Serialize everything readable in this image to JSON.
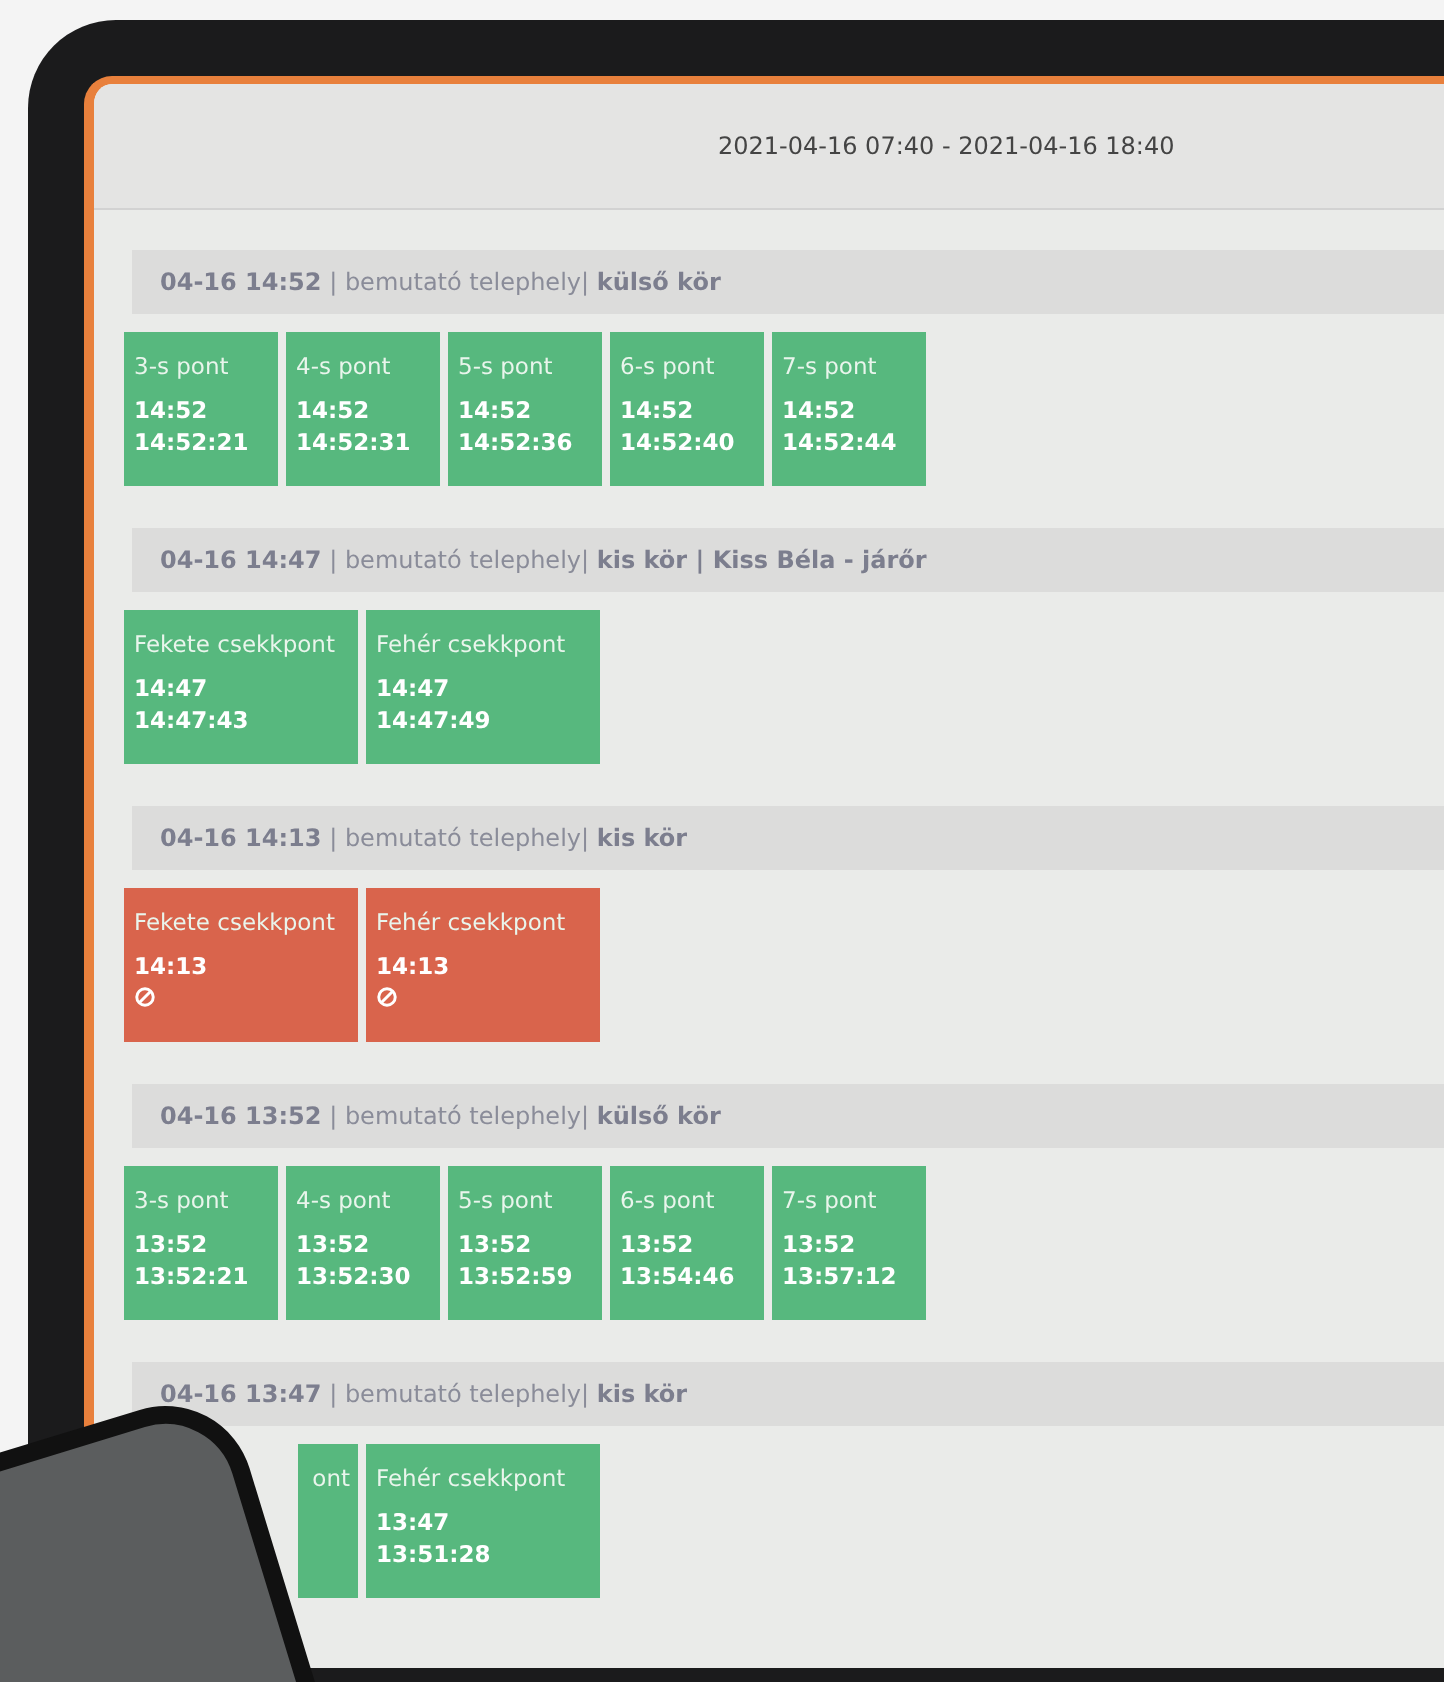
{
  "header": {
    "range": "2021-04-16 07:40 - 2021-04-16 18:40"
  },
  "groups": [
    {
      "title": "**04-16 14:52** | bemutató telephely| **külső kör**",
      "cards": [
        {
          "kind": "ok",
          "label": "3-s pont",
          "time": "14:52",
          "done": "14:52:21"
        },
        {
          "kind": "ok",
          "label": "4-s pont",
          "time": "14:52",
          "done": "14:52:31"
        },
        {
          "kind": "ok",
          "label": "5-s pont",
          "time": "14:52",
          "done": "14:52:36"
        },
        {
          "kind": "ok",
          "label": "6-s pont",
          "time": "14:52",
          "done": "14:52:40"
        },
        {
          "kind": "ok",
          "label": "7-s pont",
          "time": "14:52",
          "done": "14:52:44"
        }
      ]
    },
    {
      "title": "**04-16 14:47** | bemutató telephely| **kis kör | Kiss Béla - járőr**",
      "cards": [
        {
          "kind": "ok",
          "label": "Fekete csekkpont",
          "time": "14:47",
          "done": "14:47:43"
        },
        {
          "kind": "ok",
          "label": "Fehér csekkpont",
          "time": "14:47",
          "done": "14:47:49"
        }
      ]
    },
    {
      "title": "**04-16 14:13** | bemutató telephely| **kis kör**",
      "cards": [
        {
          "kind": "missed",
          "label": "Fekete csekkpont",
          "time": "14:13"
        },
        {
          "kind": "missed",
          "label": "Fehér csekkpont",
          "time": "14:13"
        }
      ]
    },
    {
      "title": "**04-16 13:52** | bemutató telephely| **külső kör**",
      "cards": [
        {
          "kind": "ok",
          "label": "3-s pont",
          "time": "13:52",
          "done": "13:52:21"
        },
        {
          "kind": "ok",
          "label": "4-s pont",
          "time": "13:52",
          "done": "13:52:30"
        },
        {
          "kind": "ok",
          "label": "5-s pont",
          "time": "13:52",
          "done": "13:52:59"
        },
        {
          "kind": "ok",
          "label": "6-s pont",
          "time": "13:52",
          "done": "13:54:46"
        },
        {
          "kind": "ok",
          "label": "7-s pont",
          "time": "13:52",
          "done": "13:57:12"
        }
      ]
    },
    {
      "title": "**04-16 13:47** | bemutató telephely| **kis kör**",
      "cards": [
        {
          "kind": "ok",
          "partial": true,
          "label": "ont"
        },
        {
          "kind": "ok",
          "label": "Fehér csekkpont",
          "time": "13:47",
          "done": "13:51:28"
        }
      ]
    }
  ]
}
